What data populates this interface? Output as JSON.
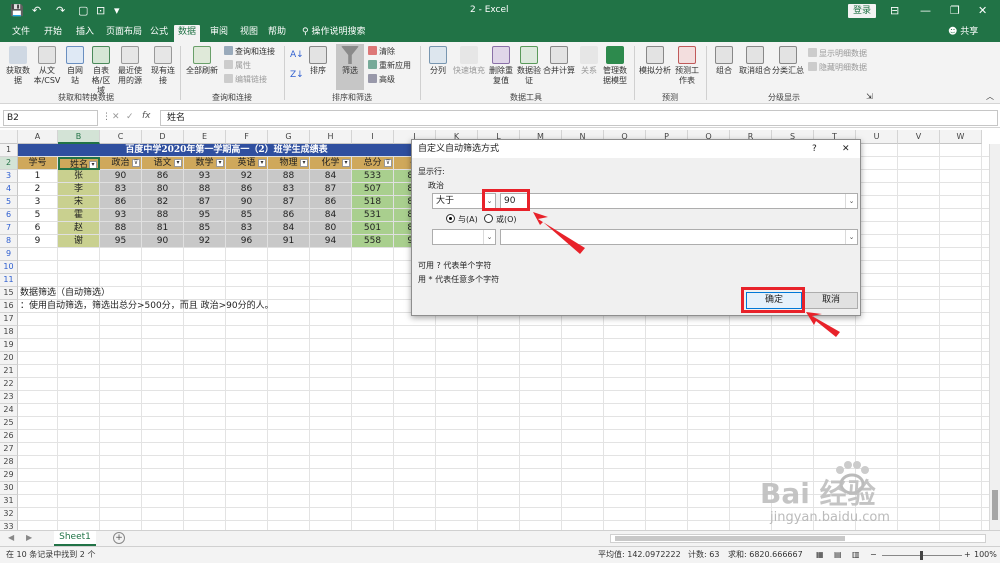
{
  "window": {
    "title": "2  -  Excel",
    "login": "登录",
    "share": "共享"
  },
  "tabs": [
    "文件",
    "开始",
    "插入",
    "页面布局",
    "公式",
    "数据",
    "审阅",
    "视图",
    "帮助",
    "操作说明搜索"
  ],
  "ribbon": {
    "get_data": "获取数据",
    "from_csv": "从文本/CSV",
    "from_web": "自网站",
    "from_table": "自表格/区域",
    "recent": "最近使用的源",
    "existing": "现有连接",
    "refresh_all": "全部刷新",
    "queries": "查询和连接",
    "properties": "属性",
    "edit_links": "编辑链接",
    "sort": "排序",
    "filter": "筛选",
    "clear": "清除",
    "reapply": "重新应用",
    "advanced": "高级",
    "split": "分列",
    "flash_fill": "快速填充",
    "remove_dup": "删除重复值",
    "validation": "数据验证",
    "consolidate": "合并计算",
    "relations": "关系",
    "data_model": "管理数据模型",
    "whatif": "模拟分析",
    "forecast": "预测工作表",
    "group": "组合",
    "ungroup": "取消组合",
    "subtotal": "分类汇总",
    "show_detail": "显示明细数据",
    "hide_detail": "隐藏明细数据",
    "groups": [
      "获取和转换数据",
      "查询和连接",
      "排序和筛选",
      "数据工具",
      "预测",
      "分级显示"
    ]
  },
  "formula_bar": {
    "name_box": "B2",
    "fx": "fx",
    "content": "姓名"
  },
  "columns": [
    "A",
    "B",
    "C",
    "D",
    "E",
    "F",
    "G",
    "H",
    "I",
    "J",
    "K",
    "L",
    "M",
    "N",
    "O",
    "P",
    "Q",
    "R",
    "S",
    "T",
    "U",
    "V",
    "W"
  ],
  "rows": [
    "1",
    "2",
    "3",
    "4",
    "5",
    "6",
    "7",
    "8",
    "9",
    "10",
    "11",
    "15",
    "16",
    "17",
    "18",
    "19",
    "20",
    "21",
    "22",
    "23",
    "24",
    "25",
    "26",
    "27",
    "28",
    "29",
    "30",
    "31",
    "32",
    "33",
    "34"
  ],
  "sheet": {
    "title": "百度中学2020年第一学期高一（2）班学生成绩表",
    "headers": [
      "学号",
      "姓名",
      "政治",
      "语文",
      "数学",
      "英语",
      "物理",
      "化学",
      "总分",
      "平"
    ],
    "data": [
      [
        "1",
        "张",
        "90",
        "86",
        "93",
        "92",
        "88",
        "84",
        "533",
        "88."
      ],
      [
        "2",
        "李",
        "83",
        "80",
        "88",
        "86",
        "83",
        "87",
        "507",
        "84."
      ],
      [
        "3",
        "宋",
        "86",
        "82",
        "87",
        "90",
        "87",
        "86",
        "518",
        "86."
      ],
      [
        "5",
        "霍",
        "93",
        "88",
        "95",
        "85",
        "86",
        "84",
        "531",
        "88."
      ],
      [
        "6",
        "赵",
        "88",
        "81",
        "85",
        "83",
        "84",
        "80",
        "501",
        "83."
      ],
      [
        "9",
        "谢",
        "95",
        "90",
        "92",
        "96",
        "91",
        "94",
        "558",
        "93."
      ]
    ],
    "note1": "数据筛选（自动筛选）",
    "note2": "：使用自动筛选，筛选出总分>500分，而且 政治>90分的人。"
  },
  "dialog": {
    "title": "自定义自动筛选方式",
    "help": "?",
    "close": "✕",
    "show_rows": "显示行:",
    "field": "政治",
    "op1": "大于",
    "val1": "90",
    "and_label": "与(A)",
    "or_label": "或(O)",
    "hint1": "可用 ? 代表单个字符",
    "hint2": "用 * 代表任意多个字符",
    "ok": "确定",
    "cancel": "取消"
  },
  "sheet_tab": "Sheet1",
  "status": {
    "left": "在 10 条记录中找到 2 个",
    "average": "平均值: 142.0972222",
    "count": "计数: 63",
    "sum": "求和: 6820.666667",
    "zoom": "100%"
  },
  "watermark": {
    "brand": "Bai  经验",
    "url": "jingyan.baidu.com"
  },
  "colors": {
    "accent": "#217346",
    "header_fill": "#cfa85b",
    "name_fill": "#c9d08f",
    "total_fill": "#a9cf8e",
    "title_fill": "#2f4f9f",
    "highlight": "#e8222a"
  }
}
